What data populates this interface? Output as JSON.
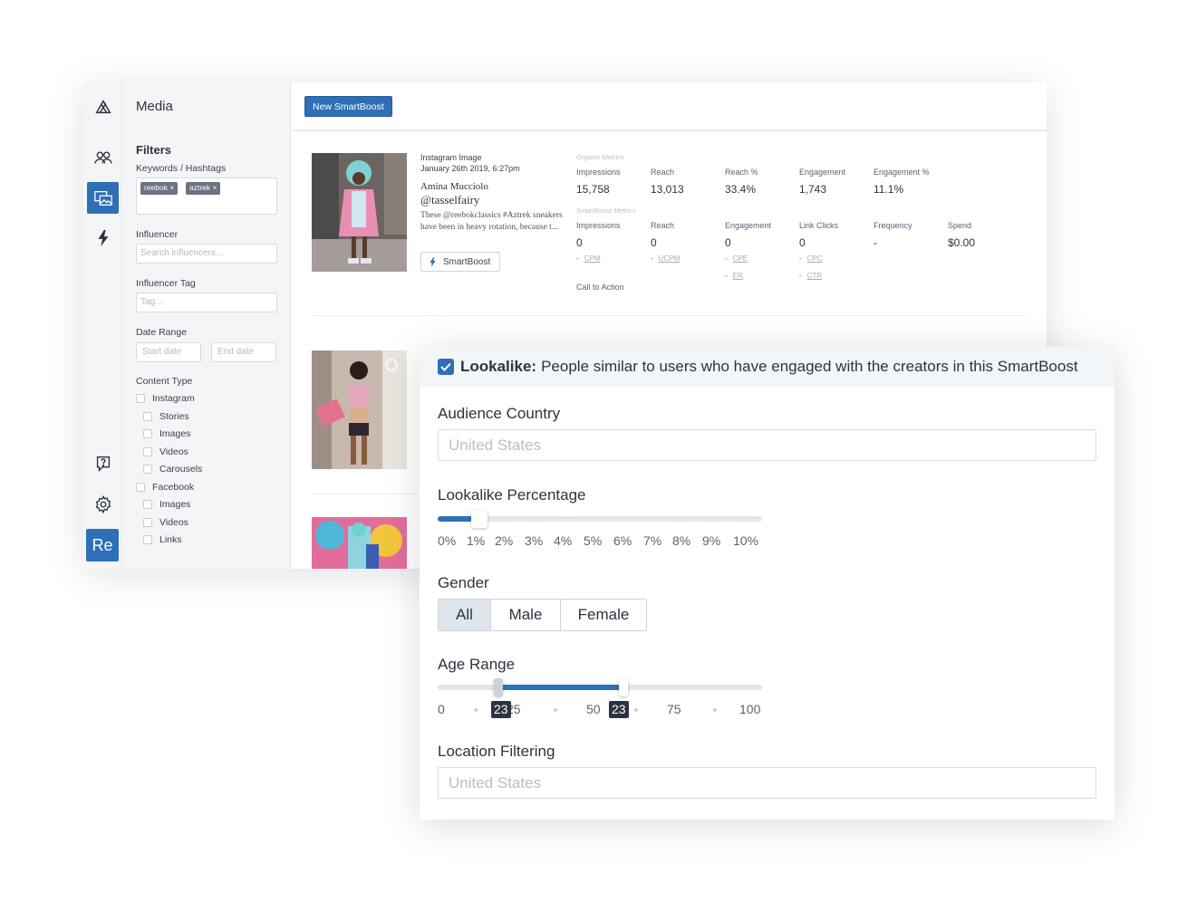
{
  "sidebar": {
    "media_title": "Media",
    "avatar_label": "Re"
  },
  "filters": {
    "title": "Filters",
    "keywords_label": "Keywords / Hashtags",
    "keyword_chips": [
      "reebok ×",
      "aztrek ×"
    ],
    "influencer_label": "Influencer",
    "influencer_placeholder": "Search influencers...",
    "influencer_tag_label": "Influencer Tag",
    "tag_placeholder": "Tag...",
    "date_range_label": "Date Range",
    "start_date_placeholder": "Start date",
    "end_date_placeholder": "End date",
    "content_type_label": "Content Type",
    "content_types": [
      "Instagram",
      "Stories",
      "Images",
      "Videos",
      "Carousels",
      "Facebook",
      "Images",
      "Videos",
      "Links"
    ]
  },
  "toolbar": {
    "new_smartboost_label": "New SmartBoost"
  },
  "post": {
    "type": "Instagram Image",
    "date": "January 26th 2019, 6:27pm",
    "name": "Amina Mucciolo",
    "handle": "@tasselfairy",
    "caption": "These @reebokclassics #Aztrek sneakers have been in heavy rotation, because t...",
    "smartboost_button": "SmartBoost",
    "call_to_action": "Call to Action"
  },
  "organic_metrics": {
    "section": "Organic Metrics",
    "items": [
      {
        "label": "Impressions",
        "value": "15,758"
      },
      {
        "label": "Reach",
        "value": "13,013"
      },
      {
        "label": "Reach %",
        "value": "33.4%"
      },
      {
        "label": "Engagement",
        "value": "1,743"
      },
      {
        "label": "Engagement %",
        "value": "11.1%"
      }
    ]
  },
  "smartboost_metrics": {
    "section": "SmartBoost Metrics",
    "items": [
      {
        "label": "Impressions",
        "value": "0"
      },
      {
        "label": "Reach",
        "value": "0"
      },
      {
        "label": "Engagement",
        "value": "0"
      },
      {
        "label": "Link Clicks",
        "value": "0"
      },
      {
        "label": "Frequency",
        "value": "-"
      },
      {
        "label": "Spend",
        "value": "$0.00"
      }
    ],
    "sub_metrics": [
      "CPM",
      "UCPM",
      "CPE",
      "ER",
      "CPC",
      "CTR"
    ],
    "dash": "-"
  },
  "panel": {
    "lookalike_title": "Lookalike:",
    "lookalike_desc": "People similar to users who have engaged with the creators in this SmartBoost",
    "audience_country_label": "Audience Country",
    "audience_country_placeholder": "United States",
    "lookalike_pct_label": "Lookalike Percentage",
    "lookalike_pct_value": 1,
    "lookalike_pct_ticks": [
      "0%",
      "1%",
      "2%",
      "3%",
      "4%",
      "5%",
      "6%",
      "7%",
      "8%",
      "9%",
      "10%"
    ],
    "gender_label": "Gender",
    "gender_options": [
      "All",
      "Male",
      "Female"
    ],
    "gender_selected": "All",
    "age_range_label": "Age Range",
    "age_range_min": 23,
    "age_range_max": 23,
    "age_ticks": [
      "0",
      "25",
      "50",
      "75",
      "100"
    ],
    "age_tip_min": "23",
    "age_tip_max": "23",
    "location_filtering_label": "Location Filtering",
    "location_placeholder": "United States"
  },
  "colors": {
    "accent": "#2f6fb8",
    "text": "#2d3340",
    "placeholder": "#b9bec6"
  }
}
